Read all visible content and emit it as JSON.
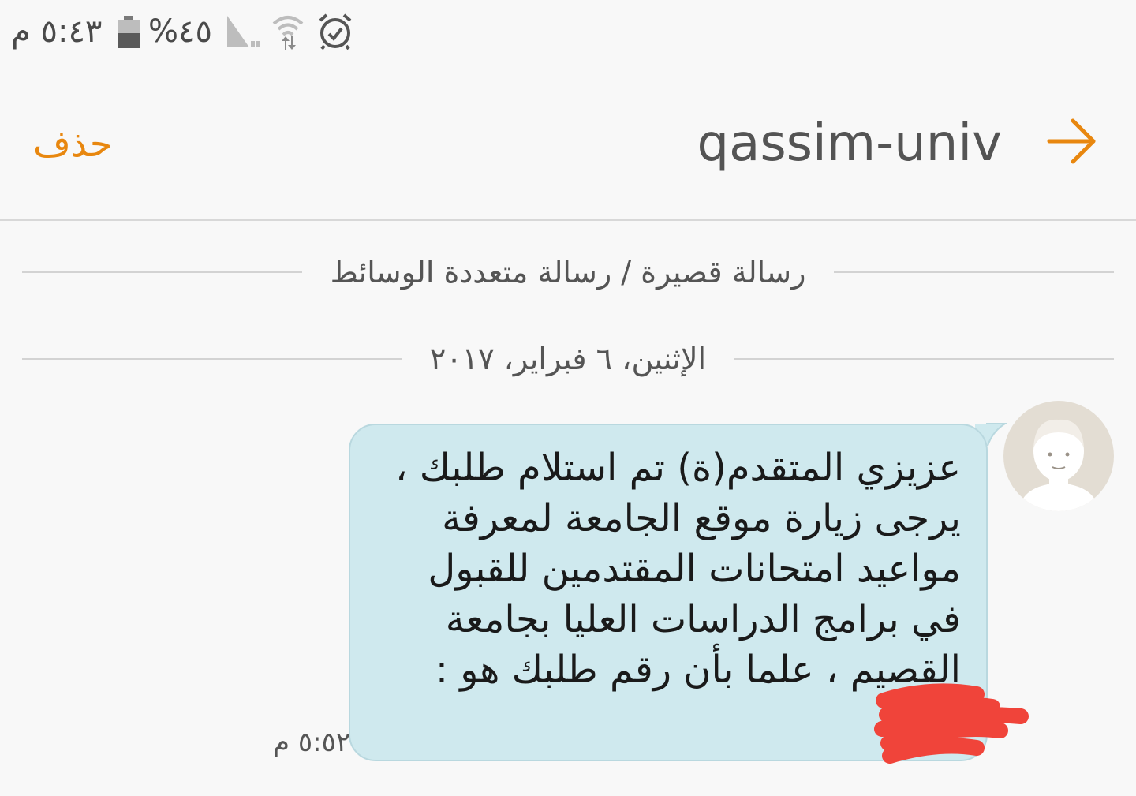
{
  "status_bar": {
    "time": "٥:٤٣ م",
    "battery_percent": "%٤٥",
    "icons": [
      "battery-icon",
      "signal-icon",
      "wifi-icon",
      "alarm-icon"
    ]
  },
  "action_bar": {
    "delete_label": "حذف",
    "contact_name": "qassim-univ",
    "back_icon": "arrow-back-icon"
  },
  "conversation": {
    "type_label": "رسالة قصيرة / رسالة متعددة الوسائط",
    "date_label": "الإثنين، ٦ فبراير، ٢٠١٧",
    "messages": [
      {
        "text": "عزيزي المتقدم(ة) تم استلام طلبك ،\nيرجى زيارة موقع الجامعة لمعرفة\nمواعيد امتحانات المقتدمين للقبول\nفي برامج الدراسات العليا بجامعة\nالقصيم ، علما بأن رقم طلبك هو :",
        "time": "٥:٥٢ م",
        "avatar_icon": "default-avatar-icon"
      }
    ]
  },
  "colors": {
    "accent": "#e8870f",
    "bubble": "#cfe9ee",
    "background": "#f8f8f8",
    "redaction": "#f0443a"
  }
}
